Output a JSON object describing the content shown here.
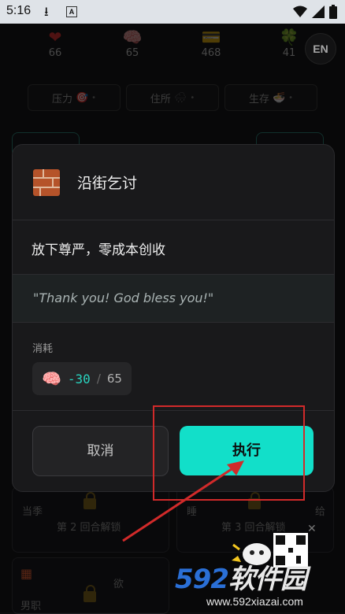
{
  "statusbar": {
    "time": "5:16",
    "a_label": "A"
  },
  "stats": [
    {
      "icon": "heart-icon",
      "glyph": "❤",
      "value": "66",
      "color": "#7a1d1d"
    },
    {
      "icon": "brain-icon",
      "glyph": "🧠",
      "value": "65",
      "color": "#6b4a55"
    },
    {
      "icon": "card-icon",
      "glyph": "💳",
      "value": "468",
      "color": "#6a5a2a"
    },
    {
      "icon": "clover-icon",
      "glyph": "🍀",
      "value": "41",
      "color": "#2b5a2b"
    }
  ],
  "lang_button": "EN",
  "pills": [
    {
      "label": "压力",
      "glyph": "🎯"
    },
    {
      "label": "住所",
      "glyph": "🌧"
    },
    {
      "label": "生存",
      "glyph": "🍜"
    }
  ],
  "background_cards": {
    "card1_text": "当季",
    "card1_lock": "第 2 回合解锁",
    "card2_lock": "第 3 回合解锁",
    "card3_label": "男职",
    "card3_text": "欲",
    "card2_text": "睡",
    "card2_suffix": "给"
  },
  "dialog": {
    "title": "沿街乞讨",
    "description": "放下尊严，零成本创收",
    "quote": "\"Thank you! God bless you!\"",
    "cost_label": "消耗",
    "cost_delta": "-30",
    "cost_separator": "/",
    "cost_current": "65",
    "cancel_label": "取消",
    "execute_label": "执行"
  },
  "watermark": {
    "main_a": "592",
    "main_b": "软件园",
    "url": "www.592xiazai.com"
  },
  "colors": {
    "accent": "#12dfc9",
    "annotation_red": "#d12a2a",
    "background": "#0d0d0e"
  }
}
